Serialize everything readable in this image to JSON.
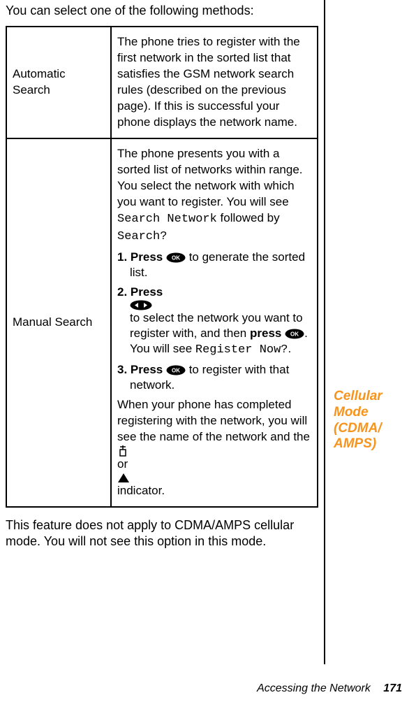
{
  "intro": "You can select one of the following methods:",
  "methods": [
    {
      "name": "Automatic Search",
      "body_plain": "The phone tries to register with the first network in the sorted list that satisfies the GSM network search rules (described on the previous page). If this is successful your phone displays the network name."
    },
    {
      "name": "Manual Search",
      "body_intro_a": "The phone presents you with a sorted list of networks within range. You select the network with which you want to register. You will see ",
      "body_intro_lcd1": "Search Network",
      "body_intro_b": " followed by ",
      "body_intro_lcd2": "Search?",
      "steps": [
        {
          "num": "1.",
          "pre": "Press ",
          "icon": "ok",
          "post": " to generate the sorted list."
        },
        {
          "num": "2.",
          "pre": "Press ",
          "icon": "lr",
          "mid": " to select the network you want to register with, and then ",
          "press2": "press ",
          "icon2": "ok",
          "post2": ". You will see ",
          "lcd": "Register Now?",
          "post3": "."
        },
        {
          "num": "3.",
          "pre": "Press ",
          "icon": "ok",
          "post": " to register with that network."
        }
      ],
      "body_after_a": "When your phone has completed registering with the network, you will see the name of the network and the ",
      "body_after_b": " or ",
      "body_after_c": " indicator."
    }
  ],
  "note": "This feature does not apply to CDMA/AMPS cellular mode. You will not see this option in this mode.",
  "side_heading": "Cellular Mode (CDMA/ AMPS)",
  "footer_title": "Accessing the Network",
  "footer_page": "171"
}
